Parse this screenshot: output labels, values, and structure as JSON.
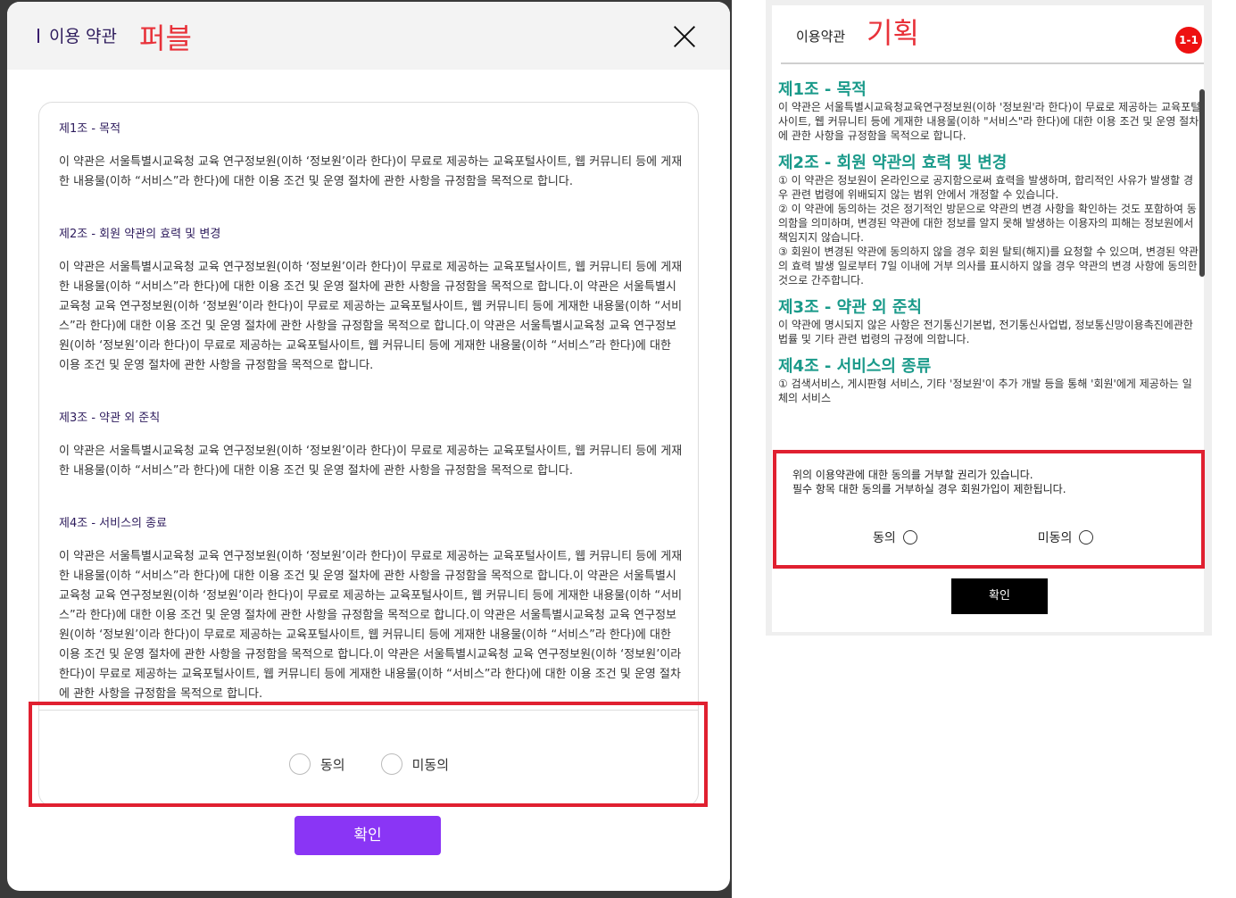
{
  "left_modal": {
    "title": "이용 약관",
    "annotation": "퍼블",
    "sections": [
      {
        "title": "제1조 - 목적",
        "body": "이 약관은 서울특별시교육청 교육 연구정보원(이하 ‘정보원’이라 한다)이 무료로 제공하는 교육포털사이트, 웹 커뮤니티 등에 게재한 내용물(이하 “서비스”라 한다)에 대한 이용 조건 및 운영 절차에 관한 사항을 규정함을 목적으로 합니다."
      },
      {
        "title": "제2조 - 회원 약관의 효력 및 변경",
        "body": "이 약관은 서울특별시교육청 교육 연구정보원(이하 ‘정보원’이라 한다)이 무료로 제공하는 교육포털사이트, 웹 커뮤니티 등에 게재한 내용물(이하 “서비스”라 한다)에 대한 이용 조건 및 운영 절차에 관한 사항을 규정함을 목적으로 합니다.이 약관은 서울특별시교육청 교육 연구정보원(이하 ‘정보원’이라 한다)이 무료로 제공하는 교육포털사이트, 웹 커뮤니티 등에 게재한 내용물(이하 “서비스”라 한다)에 대한 이용 조건 및 운영 절차에 관한 사항을 규정함을 목적으로 합니다.이 약관은 서울특별시교육청 교육 연구정보원(이하 ‘정보원’이라 한다)이 무료로 제공하는 교육포털사이트, 웹 커뮤니티 등에 게재한 내용물(이하 “서비스”라 한다)에 대한 이용 조건 및 운영 절차에 관한 사항을 규정함을 목적으로 합니다."
      },
      {
        "title": "제3조 - 약관 외 준칙",
        "body": "이 약관은 서울특별시교육청 교육 연구정보원(이하 ‘정보원’이라 한다)이 무료로 제공하는 교육포털사이트, 웹 커뮤니티 등에 게재한 내용물(이하 “서비스”라 한다)에 대한 이용 조건 및 운영 절차에 관한 사항을 규정함을 목적으로 합니다."
      },
      {
        "title": "제4조 - 서비스의 종료",
        "body": "이 약관은 서울특별시교육청 교육 연구정보원(이하 ‘정보원’이라 한다)이 무료로 제공하는 교육포털사이트, 웹 커뮤니티 등에 게재한 내용물(이하 “서비스”라 한다)에 대한 이용 조건 및 운영 절차에 관한 사항을 규정함을 목적으로 합니다.이 약관은 서울특별시교육청 교육 연구정보원(이하 ‘정보원’이라 한다)이 무료로 제공하는 교육포털사이트, 웹 커뮤니티 등에 게재한 내용물(이하 “서비스”라 한다)에 대한 이용 조건 및 운영 절차에 관한 사항을 규정함을 목적으로 합니다.이 약관은 서울특별시교육청 교육 연구정보원(이하 ‘정보원’이라 한다)이 무료로 제공하는 교육포털사이트, 웹 커뮤니티 등에 게재한 내용물(이하 “서비스”라 한다)에 대한 이용 조건 및 운영 절차에 관한 사항을 규정함을 목적으로 합니다.이 약관은 서울특별시교육청 교육 연구정보원(이하 ‘정보원’이라 한다)이 무료로 제공하는 교육포털사이트, 웹 커뮤니티 등에 게재한 내용물(이하 “서비스”라 한다)에 대한 이용 조건 및 운영 절차에 관한 사항을 규정함을 목적으로 합니다."
      }
    ],
    "agree_label": "동의",
    "disagree_label": "미동의",
    "confirm_label": "확인",
    "accent_color": "#8a35f5"
  },
  "right_panel": {
    "title": "이용약관",
    "annotation": "기획",
    "badge": "1-1",
    "sections": [
      {
        "title": "제1조 - 목적",
        "body": "이 약관은 서울특별시교육청교육연구정보원(이하 '정보원'라 한다)이 무료로 제공하는 교육포털사이트, 웹 커뮤니티 등에 게재한 내용물(이하 \"서비스\"라 한다)에 대한 이용 조건 및 운영 절차에 관한 사항을 규정함을 목적으로 합니다."
      },
      {
        "title": "제2조 - 회원 약관의 효력 및 변경",
        "body": "① 이 약관은 정보원이 온라인으로 공지함으로써 효력을 발생하며, 합리적인 사유가 발생할 경우 관련 법령에 위배되지 않는 범위 안에서 개정할 수 있습니다.\n② 이 약관에 동의하는 것은 정기적인 방문으로 약관의 변경 사항을 확인하는 것도 포함하여 동의함을 의미하며, 변경된 약관에 대한 정보를 알지 못해 발생하는 이용자의 피해는 정보원에서 책임지지 않습니다.\n③ 회원이 변경된 약관에 동의하지 않을 경우 회원 탈퇴(해지)를 요청할 수 있으며, 변경된 약관의 효력 발생 일로부터 7일 이내에 거부 의사를 표시하지 않을 경우 약관의 변경 사항에 동의한 것으로 간주합니다."
      },
      {
        "title": "제3조 - 약관 외 준칙",
        "body": "이 약관에 명시되지 않은 사항은 전기통신기본법, 전기통신사업법, 정보통신망이용촉진에관한법률 및 기타 관련 법령의 규정에 의합니다."
      },
      {
        "title": "제4조 - 서비스의 종류",
        "body": "① 검색서비스, 게시판형 서비스, 기타 '정보원'이 추가 개발 등을 통해 '회원'에게 제공하는 일체의 서비스"
      }
    ],
    "notice_line1": "위의 이용약관에 대한 동의를 거부할 권리가 있습니다.",
    "notice_line2": "필수 항목 대한 동의를 거부하실 경우 회원가입이 제한됩니다.",
    "agree_label": "동의",
    "disagree_label": "미동의",
    "confirm_label": "확인",
    "title_color": "#1a9a8a"
  },
  "annotation_color": "#e02030"
}
